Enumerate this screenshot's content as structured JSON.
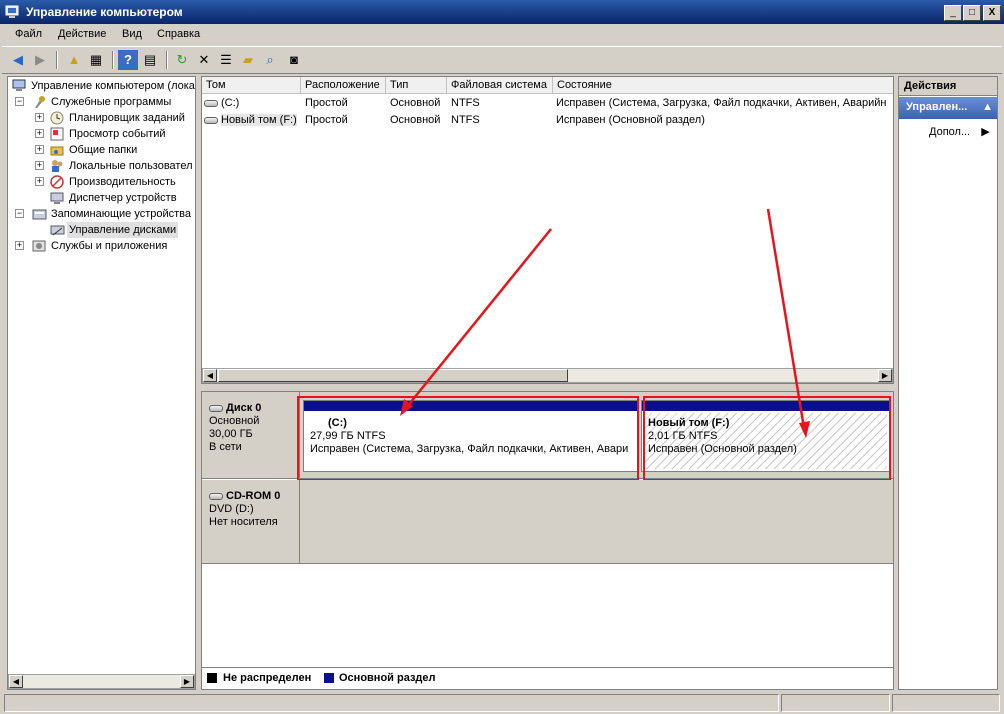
{
  "window": {
    "title": "Управление компьютером",
    "min_glyph": "_",
    "max_glyph": "□",
    "close_glyph": "X"
  },
  "menu": [
    "Файл",
    "Действие",
    "Вид",
    "Справка"
  ],
  "toolbar_icons": [
    "back-arrow-icon",
    "forward-arrow-icon",
    "up-folder-icon",
    "show-hide-tree-icon",
    "help-icon",
    "console-tree-icon",
    "refresh-icon",
    "delete-icon",
    "properties-icon",
    "open-icon",
    "search-icon",
    "magnify-icon"
  ],
  "tree": {
    "items": [
      {
        "label": "Управление компьютером (лока",
        "icon": "computer-management-icon"
      },
      {
        "label": "Служебные программы",
        "icon": "tools-icon"
      },
      {
        "label": "Планировщик заданий",
        "icon": "clock-icon"
      },
      {
        "label": "Просмотр событий",
        "icon": "event-viewer-icon"
      },
      {
        "label": "Общие папки",
        "icon": "shared-folders-icon"
      },
      {
        "label": "Локальные пользовател",
        "icon": "users-icon"
      },
      {
        "label": "Производительность",
        "icon": "performance-icon"
      },
      {
        "label": "Диспетчер устройств",
        "icon": "device-manager-icon"
      },
      {
        "label": "Запоминающие устройства",
        "icon": "storage-icon"
      },
      {
        "label": "Управление дисками",
        "icon": "disk-management-icon"
      },
      {
        "label": "Службы и приложения",
        "icon": "services-icon"
      }
    ]
  },
  "volume_list": {
    "columns": [
      "Том",
      "Расположение",
      "Тип",
      "Файловая система",
      "Состояние"
    ],
    "rows": [
      [
        "(C:)",
        "Простой",
        "Основной",
        "NTFS",
        "Исправен (Система, Загрузка, Файл подкачки, Активен, Аварийн"
      ],
      [
        "Новый том (F:)",
        "Простой",
        "Основной",
        "NTFS",
        "Исправен (Основной раздел)"
      ]
    ]
  },
  "disks": [
    {
      "name": "Диск 0",
      "type": "Основной",
      "size": "30,00 ГБ",
      "status": "В сети",
      "partitions": [
        {
          "label": "(C:)",
          "size": "27,99 ГБ NTFS",
          "status": "Исправен (Система, Загрузка, Файл подкачки, Активен, Авари"
        },
        {
          "label": "Новый том  (F:)",
          "size": "2,01 ГБ NTFS",
          "status": "Исправен (Основной раздел)"
        }
      ]
    },
    {
      "name": "CD-ROM 0",
      "type": "DVD (D:)",
      "size": "",
      "status": "Нет носителя"
    }
  ],
  "legend": [
    {
      "label": "Не распределен",
      "color": "#000000"
    },
    {
      "label": "Основной раздел",
      "color": "#0a0f8a"
    }
  ],
  "actions": {
    "header": "Действия",
    "selected": "Управлен...",
    "more": "Допол..."
  },
  "colors": {
    "titlebar": "#0a246a",
    "annotation_red": "#e8141b",
    "partition_bar": "#0a0f8a"
  }
}
